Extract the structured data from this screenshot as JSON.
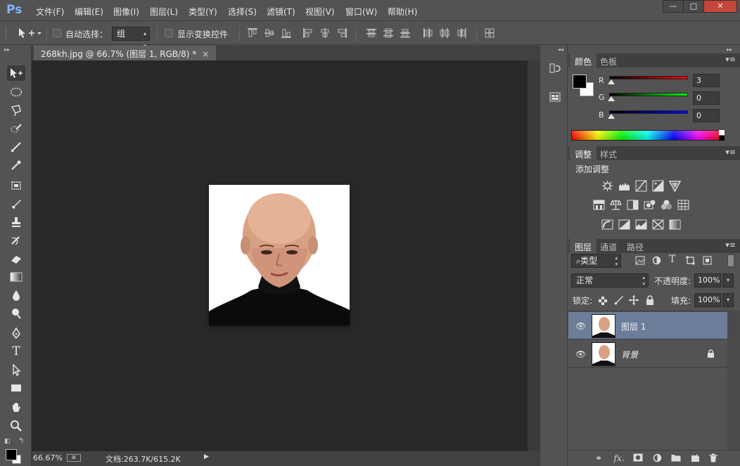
{
  "app": {
    "logo": "Ps"
  },
  "menu": {
    "items": [
      "文件(F)",
      "编辑(E)",
      "图像(I)",
      "图层(L)",
      "类型(Y)",
      "选择(S)",
      "滤镜(T)",
      "视图(V)",
      "窗口(W)",
      "帮助(H)"
    ]
  },
  "window_controls": {
    "minimize": "—",
    "maximize": "□",
    "close": "✕"
  },
  "options_bar": {
    "auto_select_label": "自动选择：",
    "auto_select_value": "组",
    "show_transform_label": "显示变换控件"
  },
  "document": {
    "tab_title": "268kh.jpg @ 66.7% (图层 1, RGB/8) *",
    "tab_close": "×",
    "zoom": "66.67%",
    "doc_info": "文档:263.7K/615.2K"
  },
  "color_panel": {
    "tabs": [
      "颜色",
      "色板"
    ],
    "channels": [
      {
        "label": "R",
        "value": "3"
      },
      {
        "label": "G",
        "value": "0"
      },
      {
        "label": "B",
        "value": "0"
      }
    ],
    "foreground": "#030000",
    "background": "#ffffff"
  },
  "adjustments_panel": {
    "tabs": [
      "调整",
      "样式"
    ],
    "heading": "添加调整"
  },
  "layers_panel": {
    "tabs": [
      "图层",
      "通道",
      "路径"
    ],
    "filter_kind": "类型",
    "blend_mode": "正常",
    "opacity_label": "不透明度:",
    "opacity_value": "100%",
    "lock_label": "锁定:",
    "fill_label": "填充:",
    "fill_value": "100%",
    "layers": [
      {
        "name": "图层 1",
        "selected": true,
        "locked": false
      },
      {
        "name": "背景",
        "selected": false,
        "locked": true
      }
    ],
    "footer_icons": [
      "link-icon",
      "fx-icon",
      "mask-icon",
      "adjustment-layer-icon",
      "group-folder-icon",
      "new-layer-icon",
      "trash-icon"
    ],
    "fx_label": "fx."
  }
}
